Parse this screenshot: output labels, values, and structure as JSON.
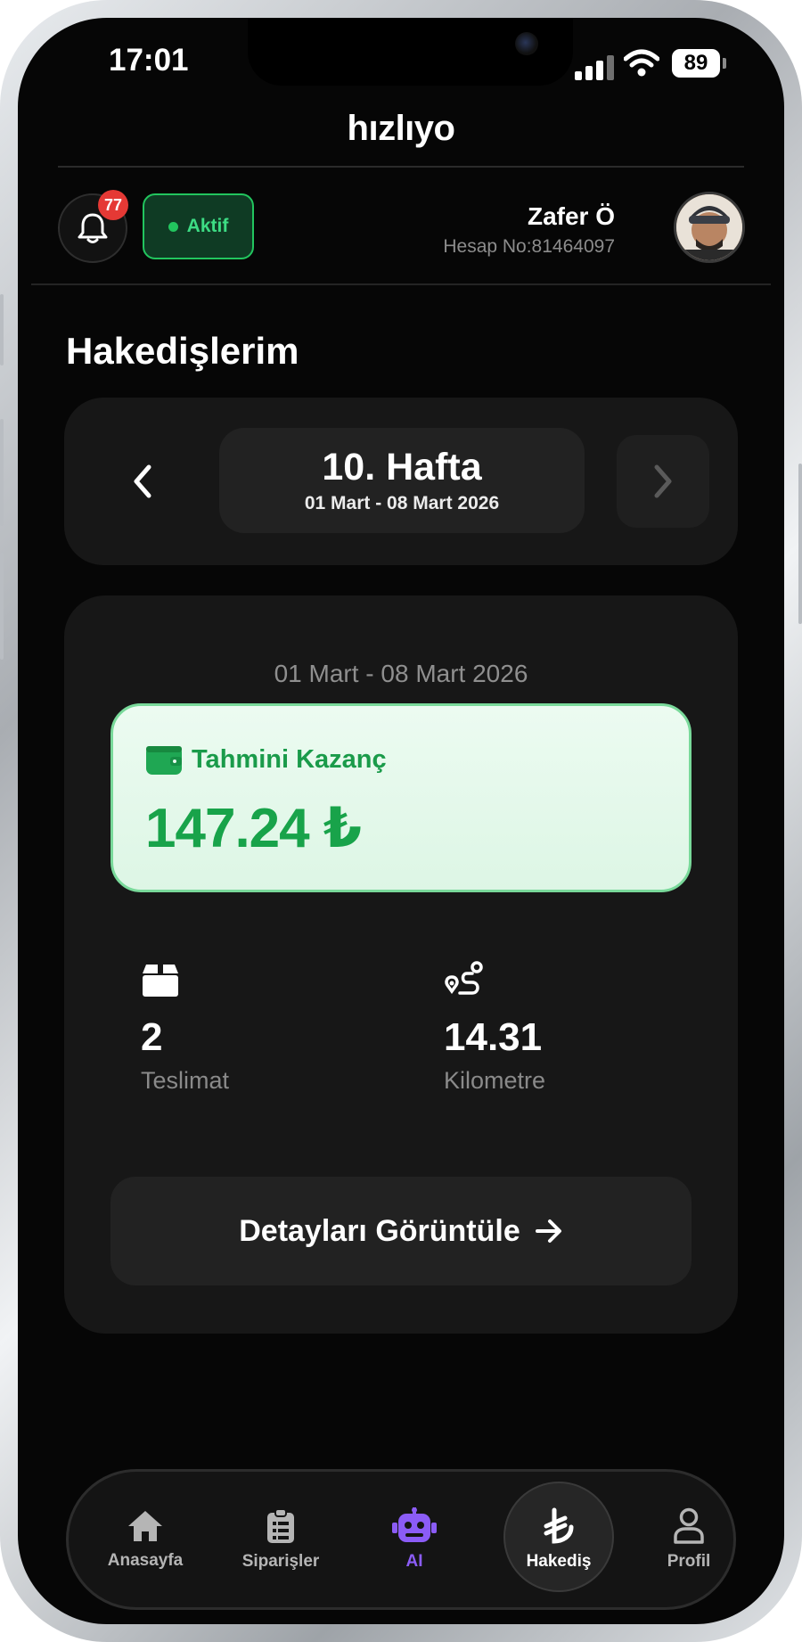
{
  "status_bar": {
    "time": "17:01",
    "battery": "89"
  },
  "app": {
    "brand": "hızlıyo"
  },
  "header": {
    "notification_count": "77",
    "status_label": "Aktif",
    "user_name": "Zafer Ö",
    "account_label": "Hesap No:81464097"
  },
  "page": {
    "title": "Hakedişlerim"
  },
  "week_selector": {
    "title": "10. Hafta",
    "range": "01 Mart - 08 Mart 2026"
  },
  "summary": {
    "range": "01 Mart - 08 Mart 2026",
    "earnings_label": "Tahmini Kazanç",
    "earnings_value": "147.24 ₺",
    "deliveries_value": "2",
    "deliveries_label": "Teslimat",
    "distance_value": "14.31",
    "distance_label": "Kilometre",
    "details_button": "Detayları Görüntüle"
  },
  "tabbar": {
    "items": [
      {
        "label": "Anasayfa",
        "icon": "home-icon"
      },
      {
        "label": "Siparişler",
        "icon": "clipboard-list-icon"
      },
      {
        "label": "AI",
        "icon": "robot-icon"
      },
      {
        "label": "Hakediş",
        "icon": "lira-icon",
        "active": true
      },
      {
        "label": "Profil",
        "icon": "user-icon"
      }
    ]
  },
  "colors": {
    "accent_green": "#22c55e",
    "earnings_green": "#18a34a",
    "ai_purple": "#8b5cf6",
    "badge_red": "#e53935"
  }
}
